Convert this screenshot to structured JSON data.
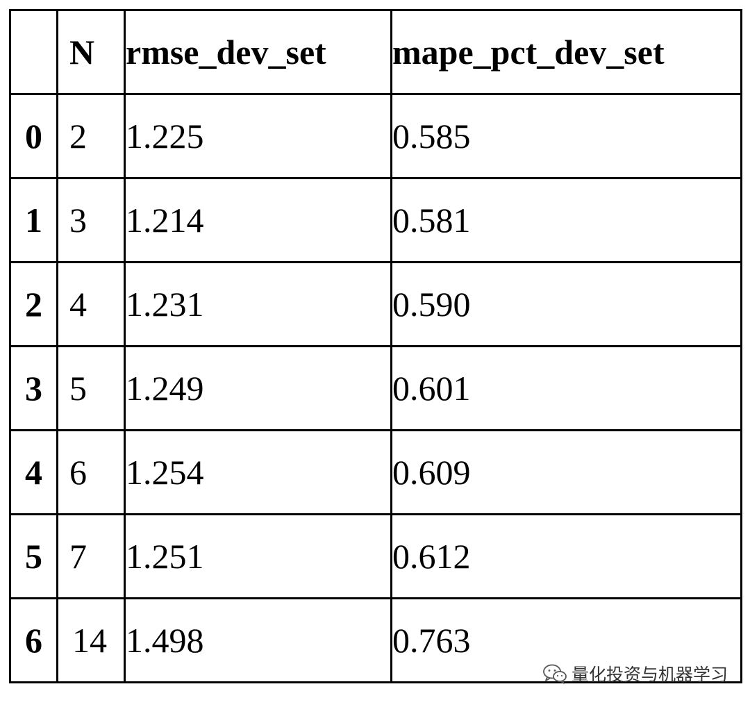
{
  "chart_data": {
    "type": "table",
    "columns": [
      "",
      "N",
      "rmse_dev_set",
      "mape_pct_dev_set"
    ],
    "rows": [
      {
        "index": "0",
        "N": "2",
        "rmse_dev_set": "1.225",
        "mape_pct_dev_set": "0.585"
      },
      {
        "index": "1",
        "N": "3",
        "rmse_dev_set": "1.214",
        "mape_pct_dev_set": "0.581"
      },
      {
        "index": "2",
        "N": "4",
        "rmse_dev_set": "1.231",
        "mape_pct_dev_set": "0.590"
      },
      {
        "index": "3",
        "N": "5",
        "rmse_dev_set": "1.249",
        "mape_pct_dev_set": "0.601"
      },
      {
        "index": "4",
        "N": "6",
        "rmse_dev_set": "1.254",
        "mape_pct_dev_set": "0.609"
      },
      {
        "index": "5",
        "N": "7",
        "rmse_dev_set": "1.251",
        "mape_pct_dev_set": "0.612"
      },
      {
        "index": "6",
        "N": "14",
        "rmse_dev_set": "1.498",
        "mape_pct_dev_set": "0.763"
      }
    ]
  },
  "watermark": {
    "icon": "wechat-icon",
    "text": "量化投资与机器学习"
  }
}
